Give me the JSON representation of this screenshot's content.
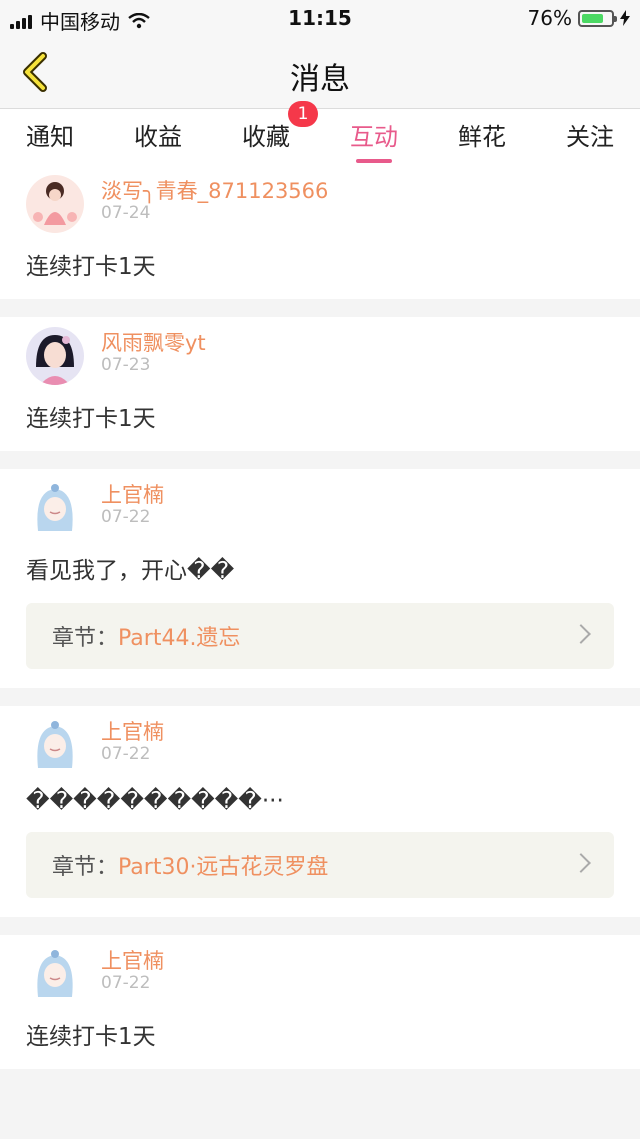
{
  "status_bar": {
    "carrier": "中国移动",
    "time": "11:15",
    "battery_percent": "76%",
    "battery_level": 0.76
  },
  "nav": {
    "title": "消息"
  },
  "tabs": [
    {
      "label": "通知",
      "active": false
    },
    {
      "label": "收益",
      "active": false
    },
    {
      "label": "收藏",
      "active": false,
      "badge": "1"
    },
    {
      "label": "互动",
      "active": true
    },
    {
      "label": "鲜花",
      "active": false
    },
    {
      "label": "关注",
      "active": false
    }
  ],
  "messages": [
    {
      "username": "淡写╮青春_871123566",
      "date": "07-24",
      "content": "连续打卡1天",
      "avatar": "avatar-girl-icon"
    },
    {
      "username": "风雨飘零yt",
      "date": "07-23",
      "content": "连续打卡1天",
      "avatar": "avatar-girl-icon"
    },
    {
      "username": "上官楠",
      "date": "07-22",
      "content": "看见我了，开心��",
      "avatar": "avatar-blue-hair-icon",
      "chapter": {
        "prefix": "章节：",
        "title": "Part44.遗忘"
      }
    },
    {
      "username": "上官楠",
      "date": "07-22",
      "content": "����������···",
      "avatar": "avatar-blue-hair-icon",
      "chapter": {
        "prefix": "章节：",
        "title": "Part30·远古花灵罗盘"
      }
    },
    {
      "username": "上官楠",
      "date": "07-22",
      "content": "连续打卡1天",
      "avatar": "avatar-blue-hair-icon"
    }
  ],
  "colors": {
    "accent": "#e85a8b",
    "username": "#ef9060",
    "badge": "#f5384a",
    "battery": "#4cd964"
  }
}
